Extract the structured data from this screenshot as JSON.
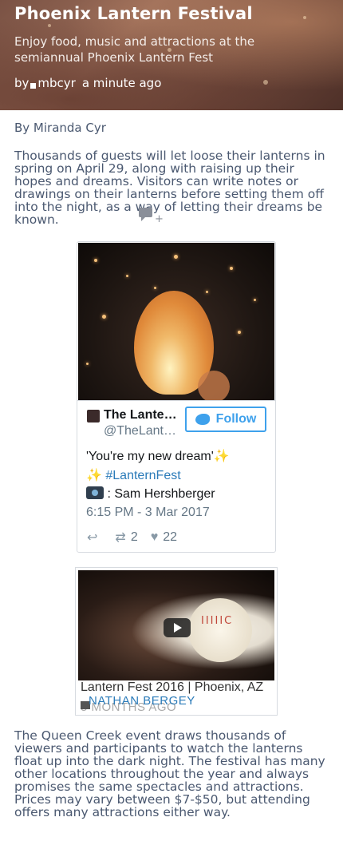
{
  "header": {
    "title": "Phoenix Lantern Festival",
    "subtitle": "Enjoy food, music and attractions at the semiannual Phoenix Lantern Fest",
    "by_label": "by",
    "author": "mbcyr",
    "time": "a minute ago"
  },
  "article": {
    "byline": "By Miranda Cyr",
    "paragraph1": "Thousands of guests will let loose their lanterns in spring on April 29, along with raising up their hopes and dreams. Visitors can write notes or drawings on their lanterns before setting them off into the night, as a way of letting their dreams be known.",
    "comment_plus": "+",
    "paragraph2": "The Queen Creek event draws thousands of viewers and participants to watch the lanterns float up into the dark night. The festival has many other locations throughout the year and always promises the same spectacles and attractions. Prices may vary between $7-$50, but attending offers many attractions either way."
  },
  "tweet": {
    "name": "The Lante…",
    "handle": "@TheLant…",
    "follow_label": "Follow",
    "text_line1": "'You're my new dream'",
    "hashtag": "#LanternFest",
    "photo_credit": ": Sam Hershberger",
    "timestamp": "6:15 PM - 3 Mar 2017",
    "retweets": "2",
    "likes": "22"
  },
  "video": {
    "title": "Lantern Fest 2016 | Phoenix, AZ",
    "author": "NATHAN BERGEY",
    "time": "5 MONTHS AGO",
    "overlay_text": "IIIIIC"
  },
  "icons": {
    "comment": "comment-icon",
    "follow_bird": "twitter-bird-icon",
    "reply": "reply-icon",
    "retweet": "retweet-icon",
    "like": "heart-icon",
    "camera": "camera-icon",
    "play": "play-icon"
  },
  "colors": {
    "text": "#4a5870",
    "link": "#2b7bb9",
    "twitter_blue": "#3ea1ec"
  }
}
